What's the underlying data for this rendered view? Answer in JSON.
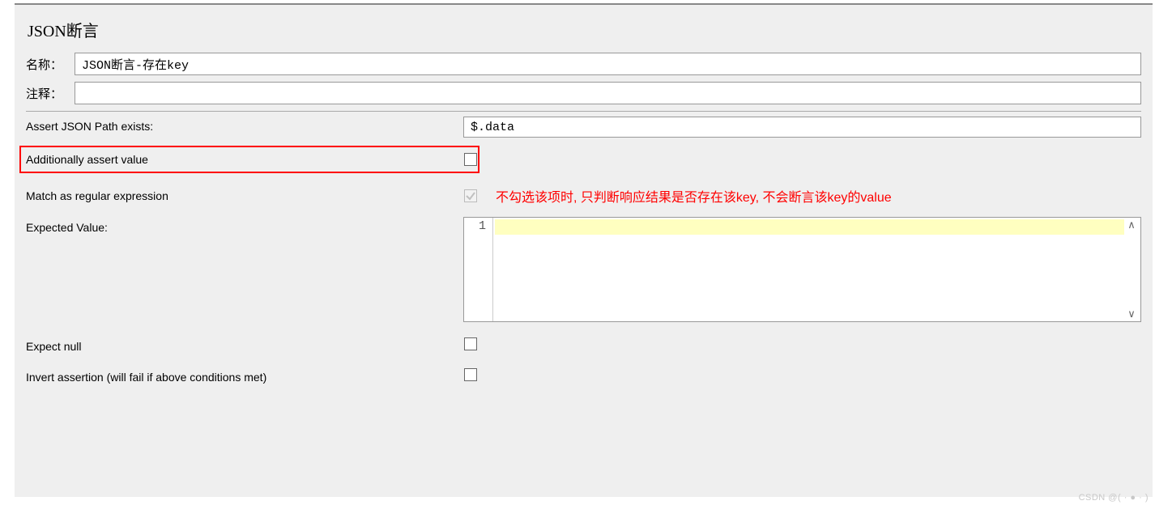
{
  "panel": {
    "title": "JSON断言",
    "name_label": "名称：",
    "name_value": "JSON断言-存在key",
    "comment_label": "注释：",
    "comment_value": "",
    "json_path_label": "Assert JSON Path exists:",
    "json_path_value": "$.data",
    "assert_value_label": "Additionally assert value",
    "assert_value_checked": false,
    "match_regex_label": "Match as regular expression",
    "match_regex_checked": true,
    "match_regex_disabled": true,
    "annotation": "不勾选该项时, 只判断响应结果是否存在该key, 不会断言该key的value",
    "expected_label": "Expected Value:",
    "expected_line_no": "1",
    "expected_value": "",
    "expect_null_label": "Expect null",
    "expect_null_checked": false,
    "invert_label": "Invert assertion (will fail if above conditions met)",
    "invert_checked": false
  },
  "watermark": "CSDN @( · ● · )"
}
